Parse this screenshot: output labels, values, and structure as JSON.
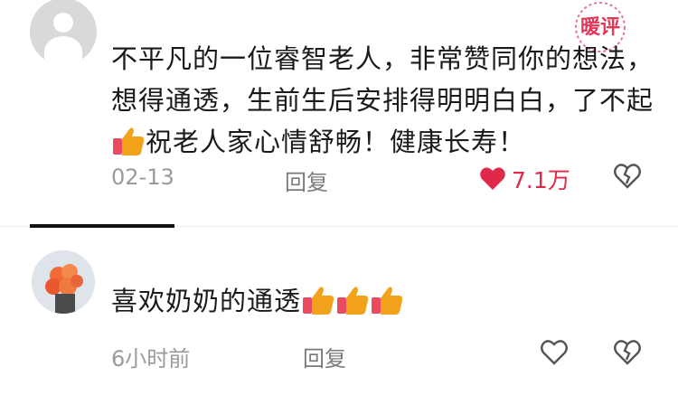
{
  "comments": [
    {
      "text_before": "不平凡的一位睿智老人，非常赞同你的想法，想得通透，生前生后安排得明明白白，了不起",
      "text_after": "祝老人家心情舒畅！健康长寿！",
      "time": "02-13",
      "reply_label": "回复",
      "like_count": "7.1万",
      "avatar_icon": "default-avatar-icon"
    },
    {
      "text_before": "喜欢奶奶的通透",
      "time": "6小时前",
      "reply_label": "回复",
      "avatar_icon": "flower-avatar-icon"
    }
  ],
  "watermark": {
    "text": "暖评"
  },
  "colors": {
    "like": "#e0284a",
    "emoji_thumb": "#f2a21a",
    "emoji_cuff": "#e84a5f"
  }
}
